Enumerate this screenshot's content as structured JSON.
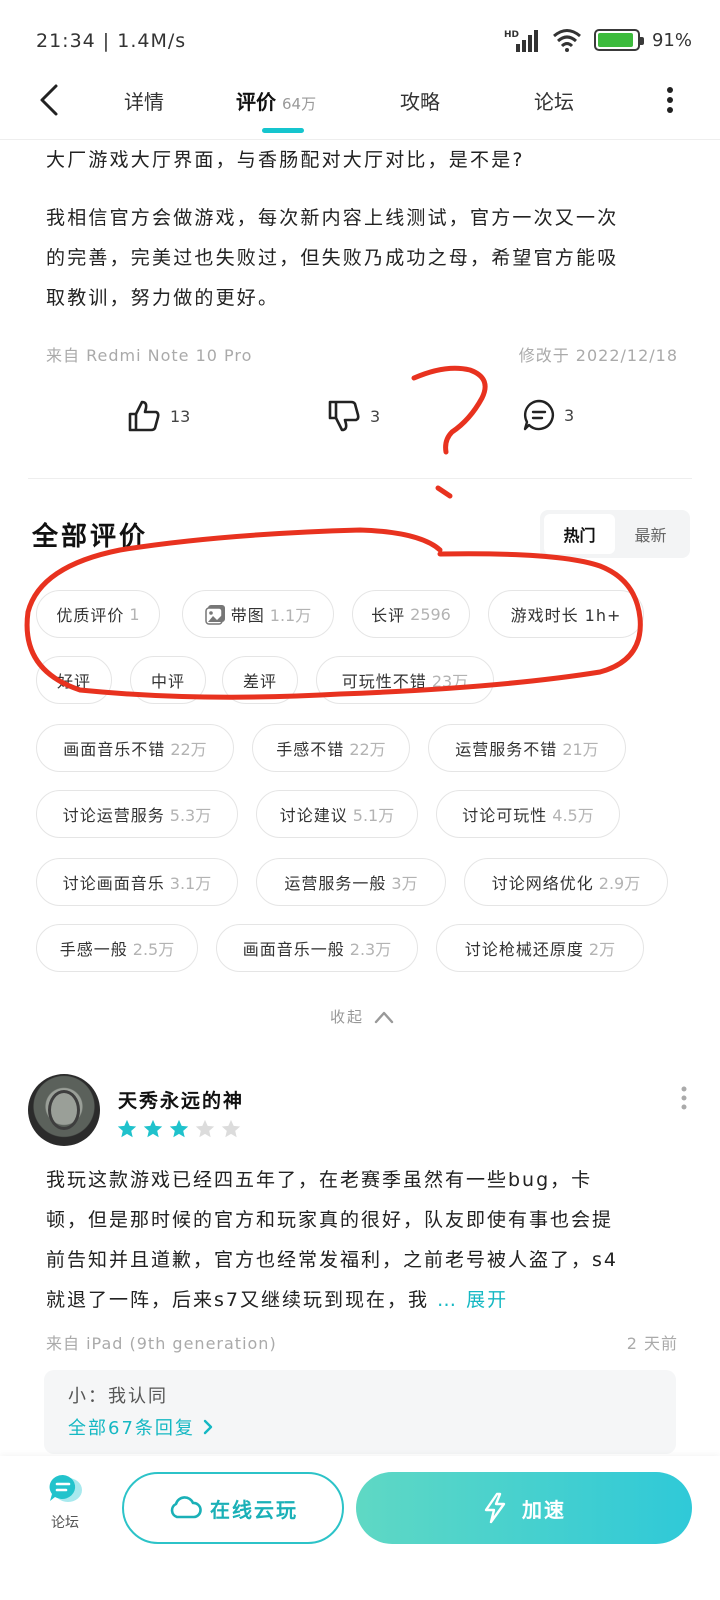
{
  "status_bar": {
    "time_speed": "21:34 | 1.4M/s",
    "network": "HD",
    "battery": "91%",
    "battery_level": 0.91
  },
  "nav": {
    "tabs": [
      {
        "label": "详情"
      },
      {
        "label": "评价",
        "count": "64万"
      },
      {
        "label": "攻略"
      },
      {
        "label": "论坛"
      }
    ]
  },
  "review": {
    "line1": "大厂游戏大厅界面，与香肠配对大厅对比，是不是?",
    "para2_l1": "我相信官方会做游戏，每次新内容上线测试，官方一次又一次",
    "para2_l2": "的完善，完美过也失败过，但失败乃成功之母，希望官方能吸",
    "para2_l3": "取教训，努力做的更好。",
    "device": "来自 Redmi Note 10 Pro",
    "modified": "修改于 2022/12/18",
    "likes": "13",
    "dislikes": "3",
    "comments": "3"
  },
  "section": {
    "title": "全部评价",
    "sort_hot": "热门",
    "sort_new": "最新"
  },
  "chips": [
    {
      "label": "优质评价",
      "count": "1"
    },
    {
      "label": "带图",
      "count": "1.1万"
    },
    {
      "label": "长评",
      "count": "2596"
    },
    {
      "label": "游戏时长 1h+",
      "count": ""
    },
    {
      "label": "好评",
      "count": ""
    },
    {
      "label": "中评",
      "count": ""
    },
    {
      "label": "差评",
      "count": ""
    },
    {
      "label": "可玩性不错",
      "count": "23万"
    },
    {
      "label": "画面音乐不错",
      "count": "22万"
    },
    {
      "label": "手感不错",
      "count": "22万"
    },
    {
      "label": "运营服务不错",
      "count": "21万"
    },
    {
      "label": "讨论运营服务",
      "count": "5.3万"
    },
    {
      "label": "讨论建议",
      "count": "5.1万"
    },
    {
      "label": "讨论可玩性",
      "count": "4.5万"
    },
    {
      "label": "讨论画面音乐",
      "count": "3.1万"
    },
    {
      "label": "运营服务一般",
      "count": "3万"
    },
    {
      "label": "讨论网络优化",
      "count": "2.9万"
    },
    {
      "label": "手感一般",
      "count": "2.5万"
    },
    {
      "label": "画面音乐一般",
      "count": "2.3万"
    },
    {
      "label": "讨论枪械还原度",
      "count": "2万"
    }
  ],
  "collapse_label": "收起",
  "comment": {
    "username": "天秀永远的神",
    "rating": 3,
    "max_rating": 5,
    "line1": "我玩这款游戏已经四五年了，在老赛季虽然有一些bug，卡",
    "line2": "顿，但是那时候的官方和玩家真的很好，队友即使有事也会提",
    "line3": "前告知并且道歉，官方也经常发福利，之前老号被人盗了，s4",
    "line4": "就退了一阵，后来s7又继续玩到现在，我",
    "expand": "… 展开",
    "device": "来自 iPad (9th generation)",
    "time": "2 天前",
    "reply": "小：我认同",
    "all_replies": "全部67条回复"
  },
  "bottom_bar": {
    "forum": "论坛",
    "cloud_play": "在线云玩",
    "boost": "加速"
  },
  "colors": {
    "accent": "#15c5ce",
    "annotation": "#e8321f",
    "star_on": "#1fc2cc",
    "star_off": "#dcdcdc"
  }
}
